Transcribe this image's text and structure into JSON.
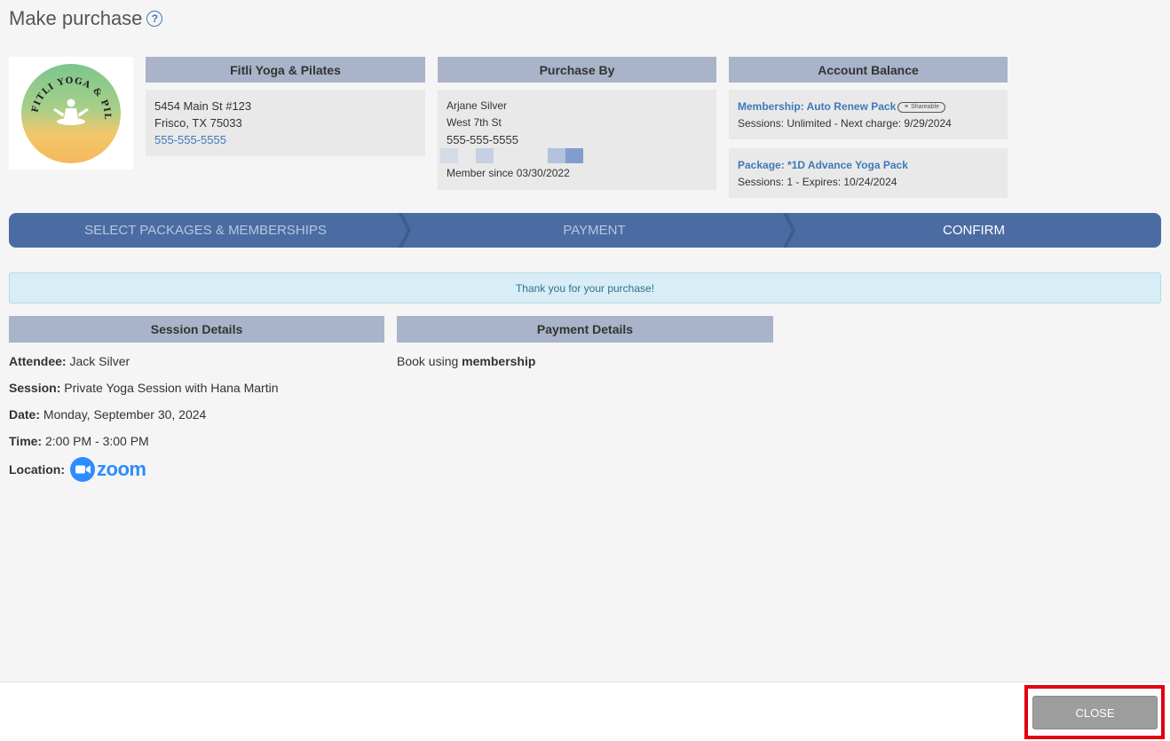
{
  "page": {
    "title": "Make purchase",
    "help_icon": "question-circle-icon"
  },
  "logo": {
    "text": "FITLI YOGA & PILATES"
  },
  "studio": {
    "header": "Fitli Yoga & Pilates",
    "address1": "5454 Main St #123",
    "address2": "Frisco, TX 75033",
    "phone": "555-555-5555"
  },
  "purchaser": {
    "header": "Purchase By",
    "name": "Arjane Silver",
    "street": "West 7th St",
    "phone": "555-555-5555",
    "member_since": "Member since 03/30/2022"
  },
  "account": {
    "header": "Account Balance",
    "membership_title": "Membership: Auto Renew Pack",
    "shareable_badge": "Shareable",
    "membership_detail": "Sessions: Unlimited -  Next charge: 9/29/2024",
    "package_title": "Package: *1D Advance Yoga Pack",
    "package_detail": "Sessions: 1 -  Expires: 10/24/2024"
  },
  "steps": [
    {
      "label": "SELECT PACKAGES & MEMBERSHIPS",
      "active": false
    },
    {
      "label": "PAYMENT",
      "active": false
    },
    {
      "label": "CONFIRM",
      "active": true
    }
  ],
  "notice": "Thank you for your purchase!",
  "session": {
    "header": "Session Details",
    "attendee_label": "Attendee:",
    "attendee": "Jack Silver",
    "session_label": "Session:",
    "session": "Private Yoga Session with Hana Martin",
    "date_label": "Date:",
    "date": "Monday, September 30, 2024",
    "time_label": "Time:",
    "time": "2:00 PM - 3:00 PM",
    "location_label": "Location:",
    "location_logo": "zoom"
  },
  "payment": {
    "header": "Payment Details",
    "text": "Book using",
    "method": "membership"
  },
  "footer": {
    "close_label": "CLOSE"
  },
  "colors": {
    "accent": "#4a6ca3",
    "panel_header": "#a9b3c9",
    "link": "#3f79b8",
    "highlight": "#e0000f"
  }
}
